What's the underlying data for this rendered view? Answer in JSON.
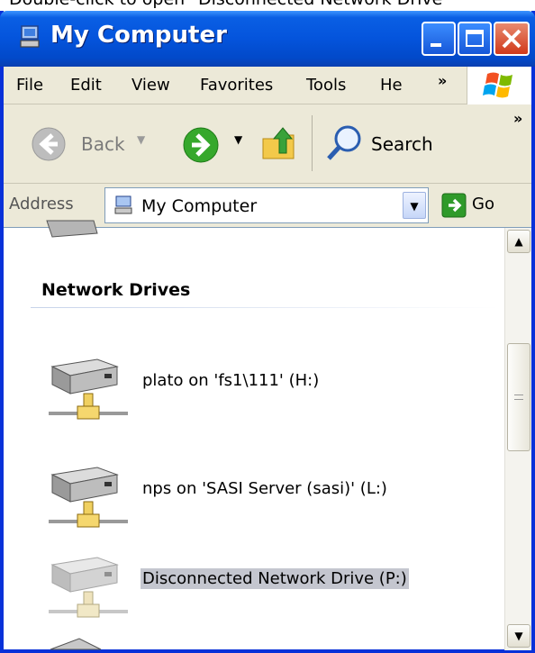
{
  "caption": "Double-click to open \"Disconnected Network Drive\"",
  "window": {
    "title": "My Computer"
  },
  "menubar": {
    "items": [
      "File",
      "Edit",
      "View",
      "Favorites",
      "Tools",
      "He"
    ],
    "chevron": "»"
  },
  "toolbar": {
    "back_label": "Back",
    "search_label": "Search",
    "chevron": "»"
  },
  "address": {
    "label": "Address",
    "value": "My Computer",
    "go_label": "Go"
  },
  "content": {
    "group_title": "Network Drives",
    "drives": [
      {
        "label": "plato on 'fs1\\111' (H:)",
        "selected": false,
        "disconnected": false
      },
      {
        "label": "nps on 'SASI Server (sasi)' (L:)",
        "selected": false,
        "disconnected": false
      },
      {
        "label": "Disconnected Network Drive (P:)",
        "selected": true,
        "disconnected": true
      }
    ]
  },
  "colors": {
    "titlebar": "#0454dc",
    "chrome": "#ece9d8",
    "selection": "#c4c6cf"
  }
}
